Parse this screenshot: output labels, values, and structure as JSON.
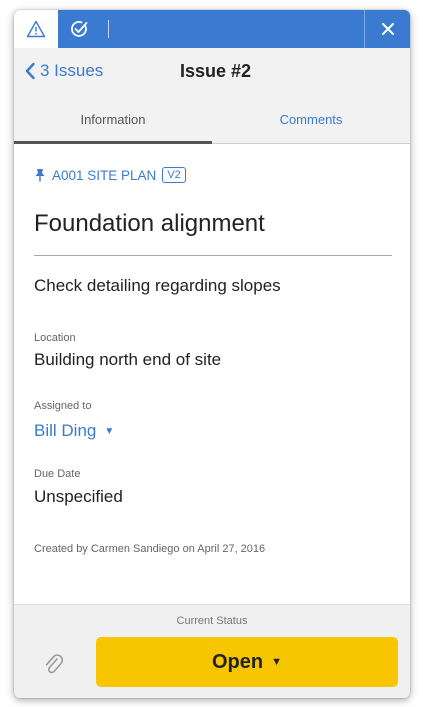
{
  "topbar": {
    "tabs": [
      {
        "icon": "warning-icon",
        "active": true
      },
      {
        "icon": "check-circle-icon",
        "active": false
      }
    ],
    "close_icon": "close-icon",
    "accent": "#3a7ad1"
  },
  "nav": {
    "back_label": "3 Issues",
    "title": "Issue #2"
  },
  "segments": {
    "information": "Information",
    "comments": "Comments"
  },
  "issue": {
    "sheet": "A001 SITE PLAN",
    "version": "V2",
    "title": "Foundation alignment",
    "description": "Check detailing regarding slopes",
    "location_label": "Location",
    "location": "Building north end of site",
    "assigned_label": "Assigned to",
    "assignee": "Bill Ding",
    "due_label": "Due Date",
    "due": "Unspecified",
    "created": "Created by Carmen Sandiego on April 27, 2016"
  },
  "footer": {
    "status_label": "Current Status",
    "status": "Open",
    "status_color": "#f7c600"
  }
}
